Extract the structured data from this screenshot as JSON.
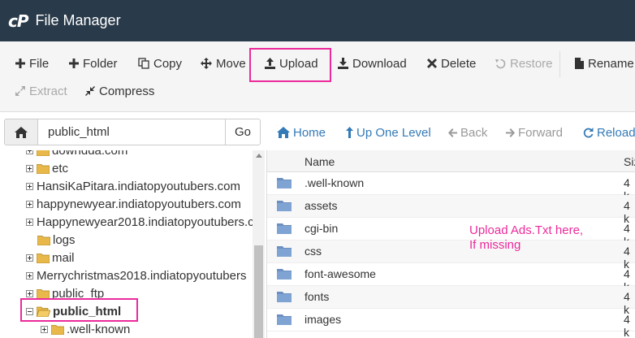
{
  "header": {
    "logo": "cP",
    "title": "File Manager"
  },
  "toolbar": {
    "file": "File",
    "folder": "Folder",
    "copy": "Copy",
    "move": "Move",
    "upload": "Upload",
    "download": "Download",
    "delete": "Delete",
    "restore": "Restore",
    "rename": "Rename",
    "extract": "Extract",
    "compress": "Compress"
  },
  "pathbar": {
    "path_value": "public_html",
    "go": "Go",
    "home": "Home",
    "up_one_level": "Up One Level",
    "back": "Back",
    "forward": "Forward",
    "reload": "Reload"
  },
  "tree": {
    "items": [
      {
        "label": "downdda.com"
      },
      {
        "label": "etc"
      },
      {
        "label": "HansiKaPitara.indiatopyoutubers.com"
      },
      {
        "label": "happynewyear.indiatopyoutubers.com"
      },
      {
        "label": "Happynewyear2018.indiatopyoutubers.c"
      },
      {
        "label": "logs"
      },
      {
        "label": "mail"
      },
      {
        "label": "Merrychristmas2018.indiatopyoutubers"
      },
      {
        "label": "public_ftp"
      },
      {
        "label": "public_html"
      },
      {
        "label": ".well-known"
      }
    ]
  },
  "files": {
    "columns": {
      "name": "Name",
      "size": "Siz"
    },
    "rows": [
      {
        "name": ".well-known",
        "size": "4 k"
      },
      {
        "name": "assets",
        "size": "4 k"
      },
      {
        "name": "cgi-bin",
        "size": "4 k"
      },
      {
        "name": "css",
        "size": "4 k"
      },
      {
        "name": "font-awesome",
        "size": "4 k"
      },
      {
        "name": "fonts",
        "size": "4 k"
      },
      {
        "name": "images",
        "size": "4 k"
      }
    ]
  },
  "annotation": {
    "line1": "Upload Ads.Txt here,",
    "line2": "If missing"
  },
  "colors": {
    "header_bg": "#293a4a",
    "highlight": "#ec2a9b",
    "link": "#337ab7",
    "folder": "#e8b84a",
    "folder_blue": "#6a8fc0"
  }
}
